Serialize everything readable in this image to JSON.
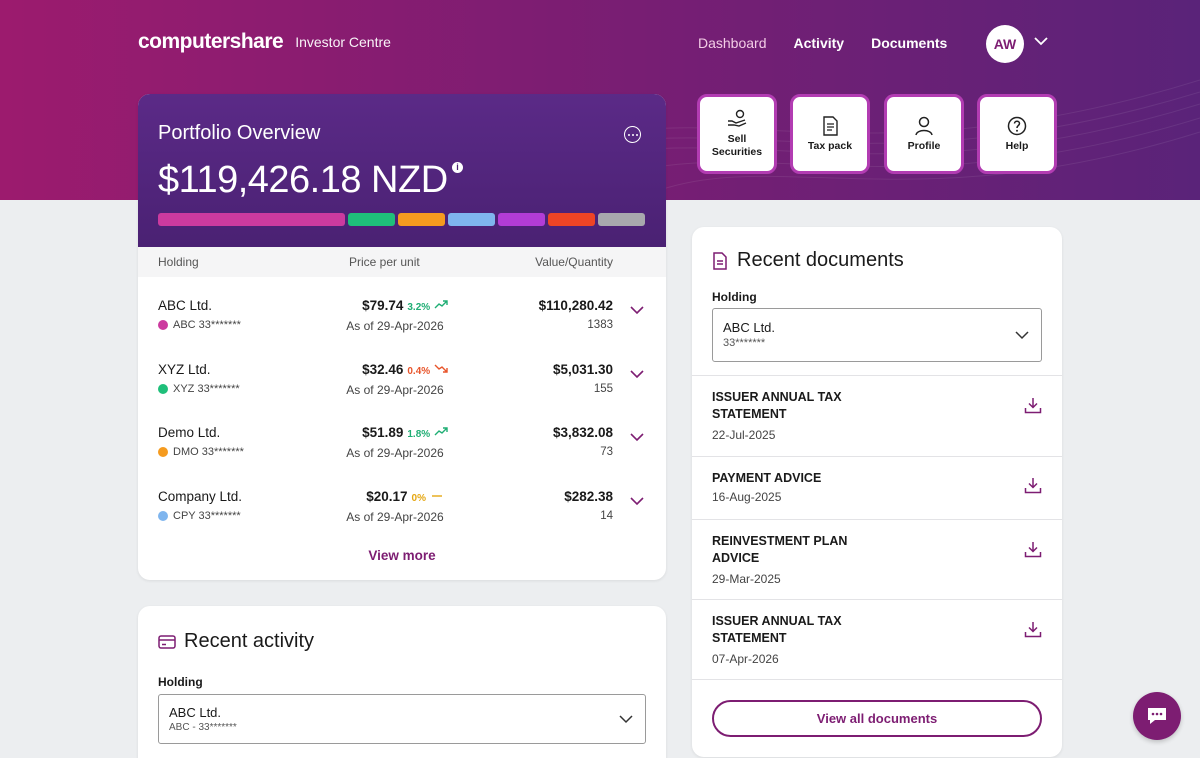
{
  "header": {
    "logo": "computershare",
    "subtitle": "Investor Centre",
    "nav": [
      "Dashboard",
      "Activity",
      "Documents"
    ],
    "avatar": "AW"
  },
  "quick_actions": [
    {
      "label": "Sell Securities",
      "icon": "hand-coins-icon"
    },
    {
      "label": "Tax pack",
      "icon": "document-icon"
    },
    {
      "label": "Profile",
      "icon": "user-icon"
    },
    {
      "label": "Help",
      "icon": "help-circle-icon"
    }
  ],
  "portfolio": {
    "title": "Portfolio Overview",
    "total": "$119,426.18 NZD",
    "info_icon": "i",
    "allocation_colors": [
      "#cc3a9f",
      "#1fbf7a",
      "#f59b1f",
      "#7fb5ee",
      "#b23cd6",
      "#ee4425",
      "#a8a8ad"
    ],
    "columns": [
      "Holding",
      "Price per unit",
      "Value/Quantity"
    ],
    "rows": [
      {
        "name": "ABC Ltd.",
        "code": "ABC 33*******",
        "dot": "#cc3a9f",
        "price": "$79.74",
        "change": "3.2%",
        "trend": "up",
        "change_color": "#1fae74",
        "asof": "As of 29-Apr-2026",
        "value": "$110,280.42",
        "qty": "1383"
      },
      {
        "name": "XYZ Ltd.",
        "code": "XYZ 33*******",
        "dot": "#1fbf7a",
        "price": "$32.46",
        "change": "0.4%",
        "trend": "down",
        "change_color": "#e8542a",
        "asof": "As of 29-Apr-2026",
        "value": "$5,031.30",
        "qty": "155"
      },
      {
        "name": "Demo Ltd.",
        "code": "DMO 33*******",
        "dot": "#f59b1f",
        "price": "$51.89",
        "change": "1.8%",
        "trend": "up",
        "change_color": "#1fae74",
        "asof": "As of 29-Apr-2026",
        "value": "$3,832.08",
        "qty": "73"
      },
      {
        "name": "Company Ltd.",
        "code": "CPY 33*******",
        "dot": "#7fb5ee",
        "price": "$20.17",
        "change": "0%",
        "trend": "flat",
        "change_color": "#e5a712",
        "asof": "As of 29-Apr-2026",
        "value": "$282.38",
        "qty": "14"
      }
    ],
    "view_more": "View more"
  },
  "activity": {
    "title": "Recent activity",
    "holding_label": "Holding",
    "selected": "ABC Ltd.",
    "selected_sub": "ABC - 33*******"
  },
  "documents": {
    "title": "Recent documents",
    "holding_label": "Holding",
    "selected": "ABC Ltd.",
    "selected_sub": "33*******",
    "items": [
      {
        "title": "ISSUER ANNUAL TAX STATEMENT",
        "date": "22-Jul-2025"
      },
      {
        "title": "PAYMENT ADVICE",
        "date": "16-Aug-2025"
      },
      {
        "title": "REINVESTMENT PLAN ADVICE",
        "date": "29-Mar-2025"
      },
      {
        "title": "ISSUER ANNUAL TAX STATEMENT",
        "date": "07-Apr-2026"
      }
    ],
    "view_all": "View all documents"
  },
  "colors": {
    "brand": "#7d1d72",
    "accent": "#b23cb2"
  }
}
